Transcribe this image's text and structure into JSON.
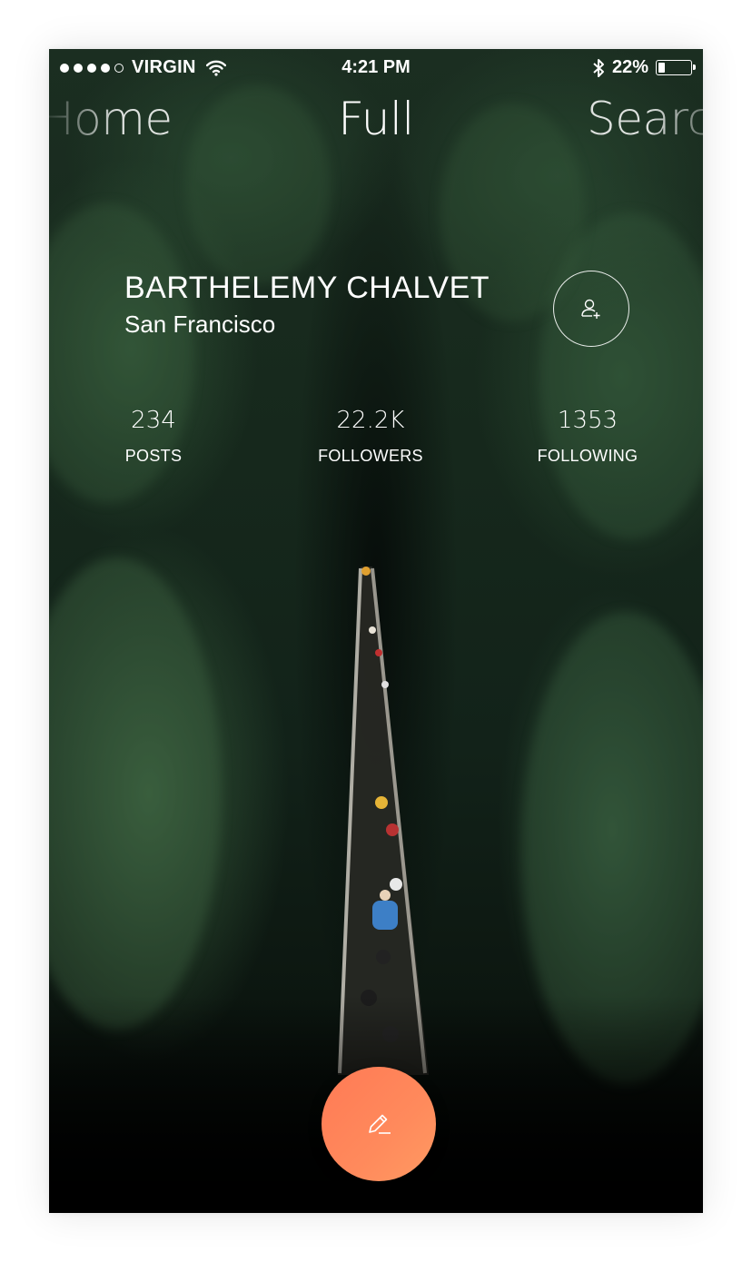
{
  "status_bar": {
    "carrier": "VIRGIN",
    "time": "4:21 PM",
    "battery_percent": "22%",
    "battery_level": 0.22
  },
  "nav": {
    "prev_tab": "Home",
    "current_tab": "Full",
    "next_tab": "Search"
  },
  "profile": {
    "name": "BARTHELEMY CHALVET",
    "city": "San Francisco"
  },
  "stats": [
    {
      "value": "234",
      "label": "POSTS"
    },
    {
      "value": "22.2K",
      "label": "FOLLOWERS"
    },
    {
      "value": "1353",
      "label": "FOLLOWING"
    }
  ],
  "icons": {
    "follow": "add-user-icon",
    "compose": "pencil-icon"
  },
  "colors": {
    "fab": "#ff7f57",
    "text": "#ffffff"
  }
}
